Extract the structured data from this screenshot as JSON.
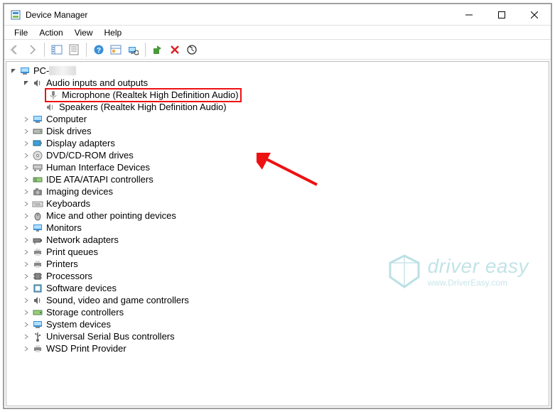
{
  "window": {
    "title": "Device Manager"
  },
  "menu": {
    "file": "File",
    "action": "Action",
    "view": "View",
    "help": "Help"
  },
  "tree": {
    "root": "PC-",
    "audio": {
      "label": "Audio inputs and outputs",
      "mic": "Microphone (Realtek High Definition Audio)",
      "spk": "Speakers (Realtek High Definition Audio)"
    },
    "computer": "Computer",
    "disk": "Disk drives",
    "display": "Display adapters",
    "dvd": "DVD/CD-ROM drives",
    "hid": "Human Interface Devices",
    "ide": "IDE ATA/ATAPI controllers",
    "imaging": "Imaging devices",
    "keyboards": "Keyboards",
    "mice": "Mice and other pointing devices",
    "monitors": "Monitors",
    "network": "Network adapters",
    "printqueues": "Print queues",
    "printers": "Printers",
    "processors": "Processors",
    "software": "Software devices",
    "sound": "Sound, video and game controllers",
    "storage": "Storage controllers",
    "system": "System devices",
    "usb": "Universal Serial Bus controllers",
    "wsd": "WSD Print Provider"
  },
  "watermark": {
    "title": "driver easy",
    "url": "www.DriverEasy.com"
  }
}
